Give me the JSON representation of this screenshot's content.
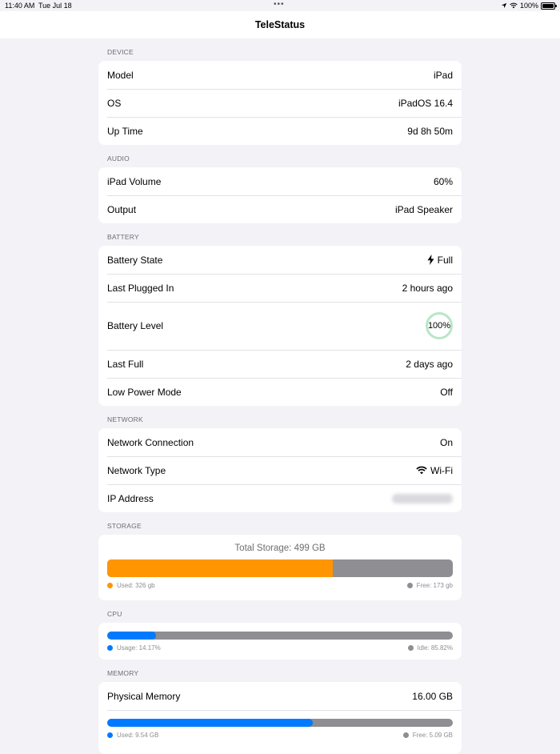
{
  "status_bar": {
    "time": "11:40 AM",
    "date": "Tue Jul 18",
    "battery": "100%",
    "dots": "•••"
  },
  "nav": {
    "title": "TeleStatus"
  },
  "colors": {
    "orange": "#ff9500",
    "blue": "#007aff",
    "gray": "#8e8e93",
    "ring": "#b8e6c8"
  },
  "device": {
    "header": "DEVICE",
    "rows": [
      {
        "label": "Model",
        "value": "iPad"
      },
      {
        "label": "OS",
        "value": "iPadOS 16.4"
      },
      {
        "label": "Up Time",
        "value": "9d 8h 50m"
      }
    ]
  },
  "audio": {
    "header": "AUDIO",
    "rows": [
      {
        "label": "iPad Volume",
        "value": "60%"
      },
      {
        "label": "Output",
        "value": "iPad Speaker"
      }
    ]
  },
  "battery": {
    "header": "BATTERY",
    "state_label": "Battery State",
    "state_value": "Full",
    "state_icon": "bolt-icon",
    "plugged_label": "Last Plugged In",
    "plugged_value": "2 hours ago",
    "level_label": "Battery Level",
    "level_value": "100%",
    "level": 1.0,
    "full_label": "Last Full",
    "full_value": "2 days ago",
    "lowpower_label": "Low Power Mode",
    "lowpower_value": "Off"
  },
  "network": {
    "header": "NETWORK",
    "connection_label": "Network Connection",
    "connection_value": "On",
    "type_label": "Network Type",
    "type_value": "Wi-Fi",
    "type_icon": "wifi-icon",
    "ip_label": "IP Address"
  },
  "storage": {
    "header": "STORAGE",
    "title": "Total Storage: 499 GB",
    "used_fraction": 0.653,
    "used_label": "Used: 326 gb",
    "free_label": "Free: 173 gb"
  },
  "cpu": {
    "header": "CPU",
    "usage_fraction": 0.1417,
    "usage_label": "Usage: 14.17%",
    "idle_label": "Idle: 85.82%"
  },
  "memory": {
    "header": "MEMORY",
    "physical_label": "Physical Memory",
    "physical_value": "16.00 GB",
    "used_fraction": 0.596,
    "used_label": "Used: 9.54 GB",
    "free_label": "Free: 5.09 GB"
  }
}
